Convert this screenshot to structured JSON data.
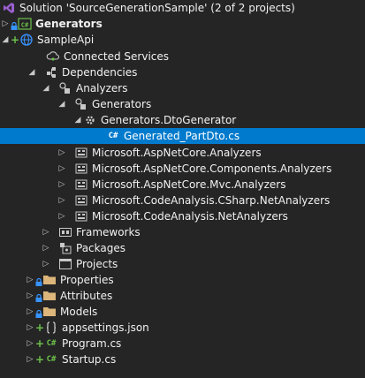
{
  "solution_explorer": {
    "items": [
      {
        "label": "Solution 'SourceGenerationSample' (2 of 2 projects)"
      },
      {
        "label": "Generators"
      },
      {
        "label": "SampleApi"
      },
      {
        "label": "Connected Services"
      },
      {
        "label": "Dependencies"
      },
      {
        "label": "Analyzers"
      },
      {
        "label": "Generators"
      },
      {
        "label": "Generators.DtoGenerator"
      },
      {
        "label": "Generated_PartDto.cs"
      },
      {
        "label": "Microsoft.AspNetCore.Analyzers"
      },
      {
        "label": "Microsoft.AspNetCore.Components.Analyzers"
      },
      {
        "label": "Microsoft.AspNetCore.Mvc.Analyzers"
      },
      {
        "label": "Microsoft.CodeAnalysis.CSharp.NetAnalyzers"
      },
      {
        "label": "Microsoft.CodeAnalysis.NetAnalyzers"
      },
      {
        "label": "Frameworks"
      },
      {
        "label": "Packages"
      },
      {
        "label": "Projects"
      },
      {
        "label": "Properties"
      },
      {
        "label": "Attributes"
      },
      {
        "label": "Models"
      },
      {
        "label": "appsettings.json"
      },
      {
        "label": "Program.cs"
      },
      {
        "label": "Startup.cs"
      }
    ],
    "icon_text": {
      "csharp": "C#"
    },
    "colors": {
      "background": "#252526",
      "selection": "#007acc",
      "text": "#f1f1f1",
      "added": "#6cc04a",
      "lock": "#3794ff"
    }
  }
}
